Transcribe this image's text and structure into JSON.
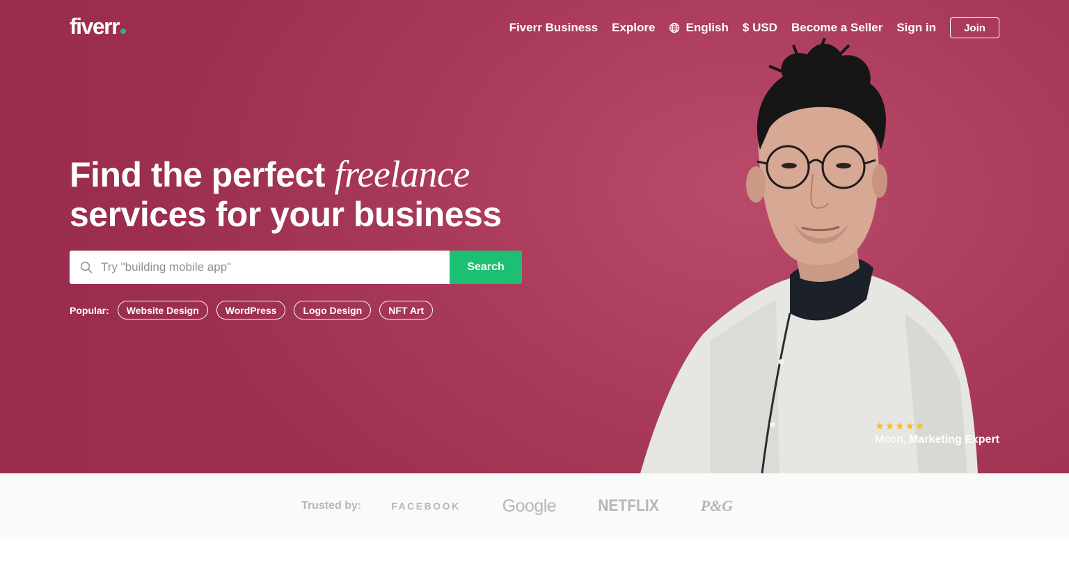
{
  "header": {
    "logo": "fiverr",
    "nav": {
      "fiverr_business": "Fiverr Business",
      "explore": "Explore",
      "language": "English",
      "currency": "$ USD",
      "become_seller": "Become a Seller",
      "sign_in": "Sign in",
      "join": "Join"
    }
  },
  "hero": {
    "headline_part1": "Find the perfect",
    "headline_italic": "freelance",
    "headline_part2": "services for your business",
    "search": {
      "placeholder": "Try \"building mobile app\"",
      "button": "Search"
    },
    "popular": {
      "label": "Popular:",
      "tags": [
        "Website Design",
        "WordPress",
        "Logo Design",
        "NFT Art"
      ]
    },
    "caption": {
      "rating": 5,
      "stars": "★★★★★",
      "name": "Moon,",
      "role": "Marketing Expert"
    }
  },
  "trusted": {
    "label": "Trusted by:",
    "brands": [
      "FACEBOOK",
      "Google",
      "NETFLIX",
      "P&G"
    ]
  },
  "colors": {
    "hero_bg": "#a93a5a",
    "accent_green": "#1dbf73",
    "star": "#ffbe0b",
    "trusted_bg": "#fafafa",
    "brand_gray": "#b5b6ba"
  }
}
